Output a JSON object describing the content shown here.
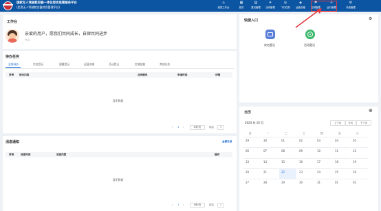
{
  "header": {
    "title_line1": "国家无人驾驶航空器一体化综合监管服务平台",
    "title_line2": "(民用无人驾驶航空器综合管理平台)",
    "nav": [
      {
        "label": "我的工作台",
        "icon": "home-icon"
      },
      {
        "label": "首页",
        "icon": "dashboard-icon"
      },
      {
        "label": "登记管理",
        "icon": "register-icon"
      },
      {
        "label": "活动管理",
        "icon": "plane-icon"
      },
      {
        "label": "飞行任务",
        "icon": "task-icon"
      },
      {
        "label": "运营合格",
        "icon": "cert-icon"
      },
      {
        "label": "空域管理",
        "icon": "airspace-icon"
      },
      {
        "label": "运行管理",
        "icon": "ops-icon"
      },
      {
        "label": "系统管理",
        "icon": "settings-icon"
      }
    ]
  },
  "workbench": {
    "title": "工作台",
    "greeting": "亲爱的用户，愿我们共同成长，自律共同进步",
    "subtitle": "个人"
  },
  "tasks": {
    "title": "待办任务",
    "tabs": [
      "全部待办",
      "实名登记",
      "国籍登记",
      "运营合格",
      "活动登记",
      "空域批复",
      "其他任务"
    ],
    "columns": [
      "序号",
      "待办内容",
      "业务模块",
      "申请时间",
      "详情"
    ],
    "empty": "暂无数据",
    "pagination": {
      "page": "1",
      "page_size": "8条/页",
      "goto": "前往",
      "goto_page": "1"
    }
  },
  "messages": {
    "title": "消息通知",
    "mark_read": "全部已读",
    "columns": [
      "序号",
      "消息时间",
      "消息内容",
      "操作"
    ],
    "empty": "暂无数据",
    "pagination": {
      "page": "1",
      "page_size": "8条/页",
      "goto": "前往",
      "goto_page": "1"
    }
  },
  "quick_entry": {
    "title": "快捷入口",
    "items": [
      {
        "label": "实名登记",
        "icon": "id-card-icon",
        "color": "#5b7fd8"
      },
      {
        "label": "活动登记",
        "icon": "target-icon",
        "color": "#3bb86a"
      }
    ]
  },
  "calendar": {
    "title": "日历",
    "month": "2024 年 10 月",
    "buttons": [
      "上个月",
      "今天",
      "下个月"
    ],
    "weekdays": [
      "日",
      "一",
      "二",
      "三",
      "四",
      "五",
      "六"
    ],
    "days": [
      "29",
      "30",
      "01",
      "02",
      "03",
      "04",
      "05",
      "06",
      "07",
      "08",
      "09",
      "10",
      "11",
      "12",
      "13",
      "14",
      "15",
      "16",
      "17",
      "18",
      "19",
      "20",
      "21",
      "22",
      "23",
      "24",
      "25",
      "26",
      "27",
      "28",
      "29",
      "30",
      "31",
      "01",
      "02"
    ],
    "selected_index": 23
  }
}
